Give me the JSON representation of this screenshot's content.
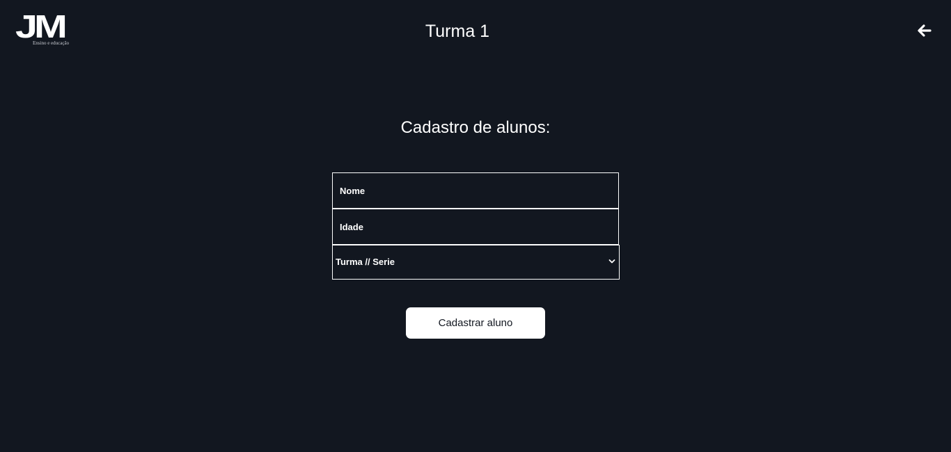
{
  "header": {
    "logo_text": "JM",
    "logo_tagline": "Ensino e educação",
    "title": "Turma 1",
    "back_icon": "arrow-left-icon"
  },
  "form": {
    "title": "Cadastro de alunos:",
    "fields": [
      {
        "placeholder": "Nome",
        "value": ""
      },
      {
        "placeholder": "Idade",
        "value": ""
      }
    ],
    "select": {
      "selected": "Turma // Serie",
      "icon": "chevron-down-icon"
    },
    "submit_label": "Cadastrar aluno"
  },
  "colors": {
    "background": "#121720",
    "foreground": "#ffffff"
  }
}
